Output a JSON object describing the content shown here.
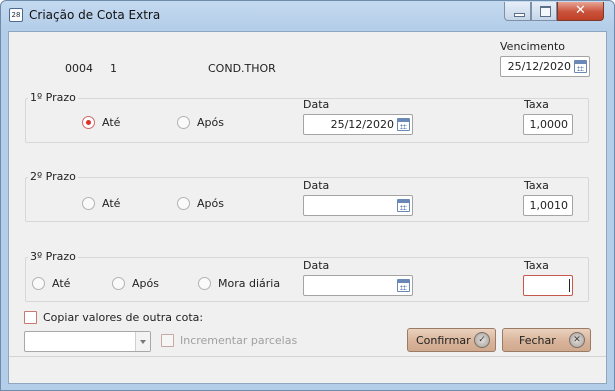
{
  "window": {
    "title": "Criação de Cota Extra"
  },
  "header": {
    "code": "0004",
    "number": "1",
    "name": "COND.THOR",
    "vencimento_label": "Vencimento",
    "vencimento_value": "25/12/2020"
  },
  "prazo1": {
    "title": "1º Prazo",
    "ate_label": "Até",
    "apos_label": "Após",
    "selected": "Até",
    "data_label": "Data",
    "data_value": "25/12/2020",
    "taxa_label": "Taxa",
    "taxa_value": "1,0000"
  },
  "prazo2": {
    "title": "2º Prazo",
    "ate_label": "Até",
    "apos_label": "Após",
    "data_label": "Data",
    "data_value": "",
    "taxa_label": "Taxa",
    "taxa_value": "1,0010"
  },
  "prazo3": {
    "title": "3º Prazo",
    "ate_label": "Até",
    "apos_label": "Após",
    "mora_label": "Mora diária",
    "data_label": "Data",
    "data_value": "",
    "taxa_label": "Taxa",
    "taxa_value": ""
  },
  "options": {
    "copiar_label": "Copiar valores de outra cota:",
    "incrementar_label": "Incrementar parcelas",
    "cota_select_value": ""
  },
  "buttons": {
    "confirmar": "Confirmar",
    "fechar": "Fechar"
  },
  "colors": {
    "accent_red": "#e0302a",
    "button_bg": "#d9b49a"
  }
}
